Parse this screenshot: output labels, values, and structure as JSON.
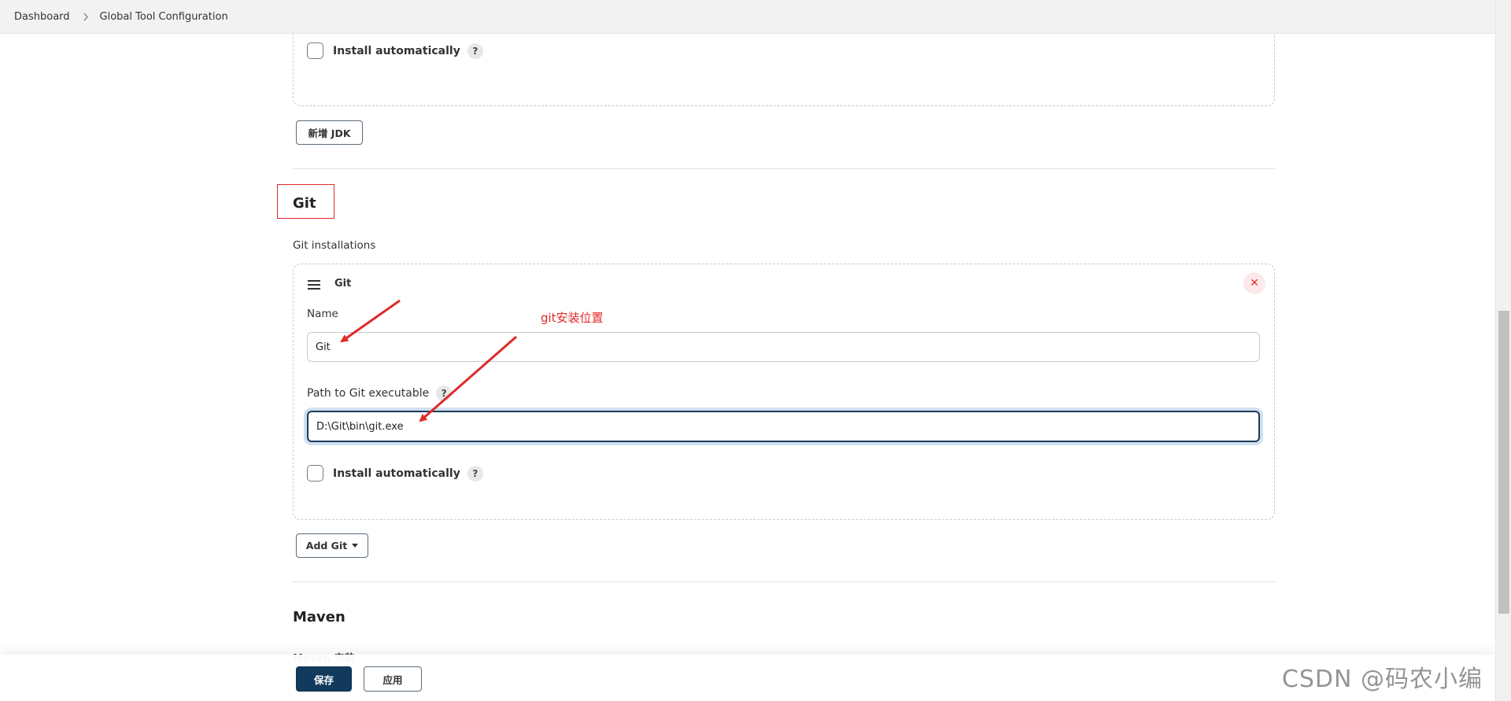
{
  "breadcrumb": {
    "items": [
      "Dashboard",
      "Global Tool Configuration"
    ]
  },
  "jdk_section": {
    "install_automatically_label": "Install automatically",
    "help_glyph": "?",
    "add_button_label": "新增 JDK"
  },
  "git_section": {
    "title": "Git",
    "installations_label": "Git installations",
    "installation": {
      "header": "Git",
      "name_label": "Name",
      "name_value": "Git",
      "path_label": "Path to Git executable",
      "path_value": "D:\\Git\\bin\\git.exe",
      "install_automatically_label": "Install automatically",
      "help_glyph": "?",
      "delete_glyph": "✕"
    },
    "add_button_label": "Add Git"
  },
  "maven_section": {
    "title": "Maven",
    "cut_label": "Maven 安装"
  },
  "annotation": {
    "text": "git安装位置",
    "color": "#e02a2a"
  },
  "footer": {
    "save_label": "保存",
    "apply_label": "应用"
  },
  "watermark": "CSDN @码农小编",
  "colors": {
    "primary": "#123a5c",
    "annotation_red": "#e02a2a",
    "focus_border": "#1e3a5a"
  }
}
